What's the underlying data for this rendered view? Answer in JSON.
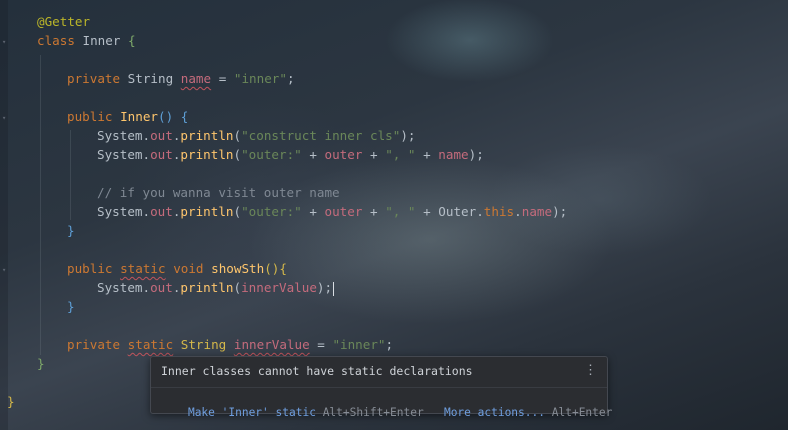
{
  "code": {
    "lines": {
      "annotation": "@Getter",
      "class_kw": "class",
      "class_name": "Inner",
      "open_brace": " {",
      "field1_mod": "private",
      "field1_type": "String",
      "field1_name": "name",
      "field1_eq": " = ",
      "field1_val": "\"inner\"",
      "semi": ";",
      "ctor_mod": "public",
      "ctor_name": "Inner",
      "ctor_parens": "() {",
      "sys": "System.",
      "out": "out",
      "println": "println",
      "print1_arg": "\"construct inner cls\"",
      "print2_str": "\"outer:\"",
      "plus": " + ",
      "outer": "outer",
      "comma_str": "\", \"",
      "name": "name",
      "close_paren_semi": ");",
      "comment": "// if you wanna visit outer name",
      "outer_class": "Outer",
      "this_kw": "this",
      "close_brace": "}",
      "m_mod": "public",
      "m_static": "static",
      "m_void": "void",
      "m_name": "showSth",
      "m_parens": "(){",
      "inner_value": "innerValue",
      "f2_mod": "private",
      "f2_static": "static",
      "f2_type": "String",
      "f2_name": "innerValue",
      "f2_val": "\"inner\""
    }
  },
  "popup": {
    "message": "Inner classes cannot have static declarations",
    "menu_icon": "vertical-dots-icon",
    "fix_label": "Make 'Inner' static",
    "fix_shortcut": "Alt+Shift+Enter",
    "more_label": "More actions...",
    "more_shortcut": "Alt+Enter"
  },
  "colors": {
    "keyword": "#cc7832",
    "string": "#6a8759",
    "field": "#c46b7c",
    "function": "#ffc66d",
    "annotation": "#bbb529",
    "link": "#6f9fe0"
  }
}
